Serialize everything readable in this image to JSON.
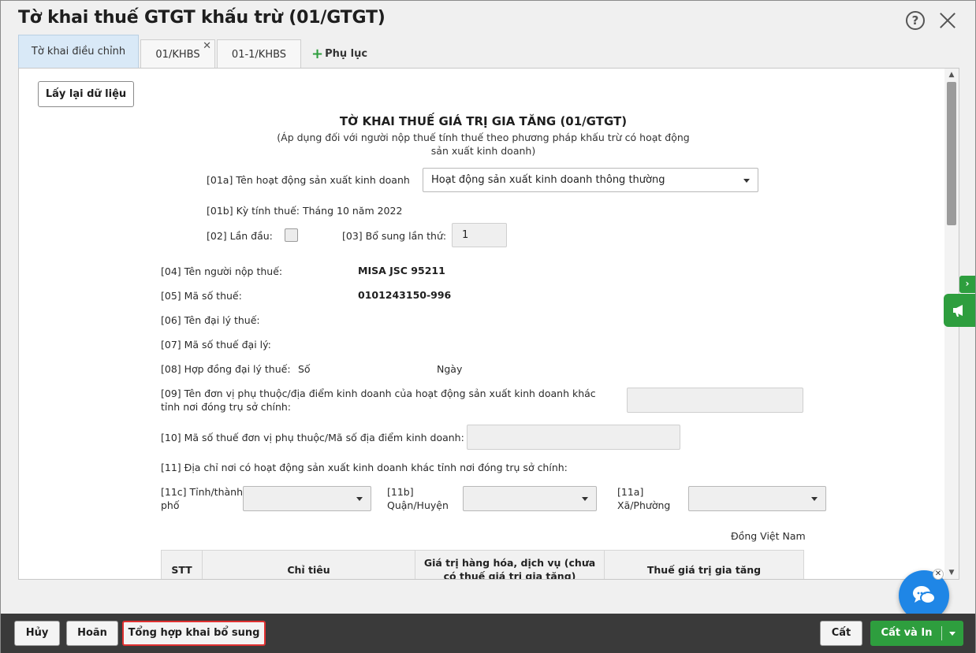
{
  "window": {
    "title": "Tờ khai thuế GTGT khấu trừ (01/GTGT)",
    "help_icon": "question-circle-icon",
    "close_icon": "close-icon"
  },
  "tabs": [
    {
      "label": "Tờ khai điều chỉnh",
      "active": true
    },
    {
      "label": "01/KHBS",
      "closable": true
    },
    {
      "label": "01-1/KHBS"
    }
  ],
  "add_appendix": {
    "icon": "plus-icon",
    "label": "Phụ lục"
  },
  "content": {
    "refresh_button": "Lấy lại dữ liệu",
    "form_title": "TỜ KHAI THUẾ GIÁ TRỊ GIA TĂNG (01/GTGT)",
    "form_subtitle_line1": "(Áp dụng đối với người nộp thuế tính thuế theo phương pháp khấu trừ có hoạt động",
    "form_subtitle_line2": "sản xuất kinh doanh)",
    "f01a_label": "[01a] Tên hoạt động sản xuất kinh doanh",
    "f01a_value": "Hoạt động sản xuất kinh doanh thông thường",
    "f01b_label": "[01b] Kỳ tính thuế: Tháng 10 năm 2022",
    "f02_label": "[02] Lần đầu:",
    "f02_checked": false,
    "f03_label": "[03] Bổ sung lần thứ:",
    "f03_value": "1",
    "f04_label": "[04] Tên người nộp thuế:",
    "f04_value": "MISA JSC 95211",
    "f05_label": "[05] Mã số thuế:",
    "f05_value": "0101243150-996",
    "f06_label": "[06] Tên đại lý thuế:",
    "f07_label": "[07] Mã số thuế đại lý:",
    "f08_label": "[08] Hợp đồng đại lý thuế:",
    "f08_so": "Số",
    "f08_ngay": "Ngày",
    "f09_label": "[09] Tên đơn vị phụ thuộc/địa điểm kinh doanh của hoạt động sản xuất kinh doanh khác tỉnh nơi đóng trụ sở chính:",
    "f10_label": "[10] Mã số thuế đơn vị phụ thuộc/Mã số địa điểm kinh doanh:",
    "f11_label": "[11] Địa chỉ nơi có hoạt động sản xuất kinh doanh khác tỉnh nơi đóng trụ sở chính:",
    "f11c_label": "[11c] Tỉnh/thành phố",
    "f11b_label": "[11b] Quận/Huyện",
    "f11a_label": "[11a] Xã/Phường",
    "currency_note": "Đồng Việt Nam",
    "table_headers": [
      "STT",
      "Chỉ tiêu",
      "Giá trị hàng hóa, dịch vụ (chưa có thuế giá trị gia tăng)",
      "Thuế giá trị gia tăng"
    ]
  },
  "side": {
    "expand_icon": "chevron-right-icon",
    "announce_icon": "megaphone-icon",
    "chat_icon": "chat-icon"
  },
  "footer": {
    "cancel": "Hủy",
    "postpone": "Hoãn",
    "summary": "Tổng hợp khai bổ sung",
    "save": "Cất",
    "save_print": "Cất và In"
  },
  "colors": {
    "accent_green": "#2e9e3e",
    "chat_blue": "#1f86e6",
    "highlight_red": "#e03131",
    "active_tab": "#d9e9f7"
  }
}
